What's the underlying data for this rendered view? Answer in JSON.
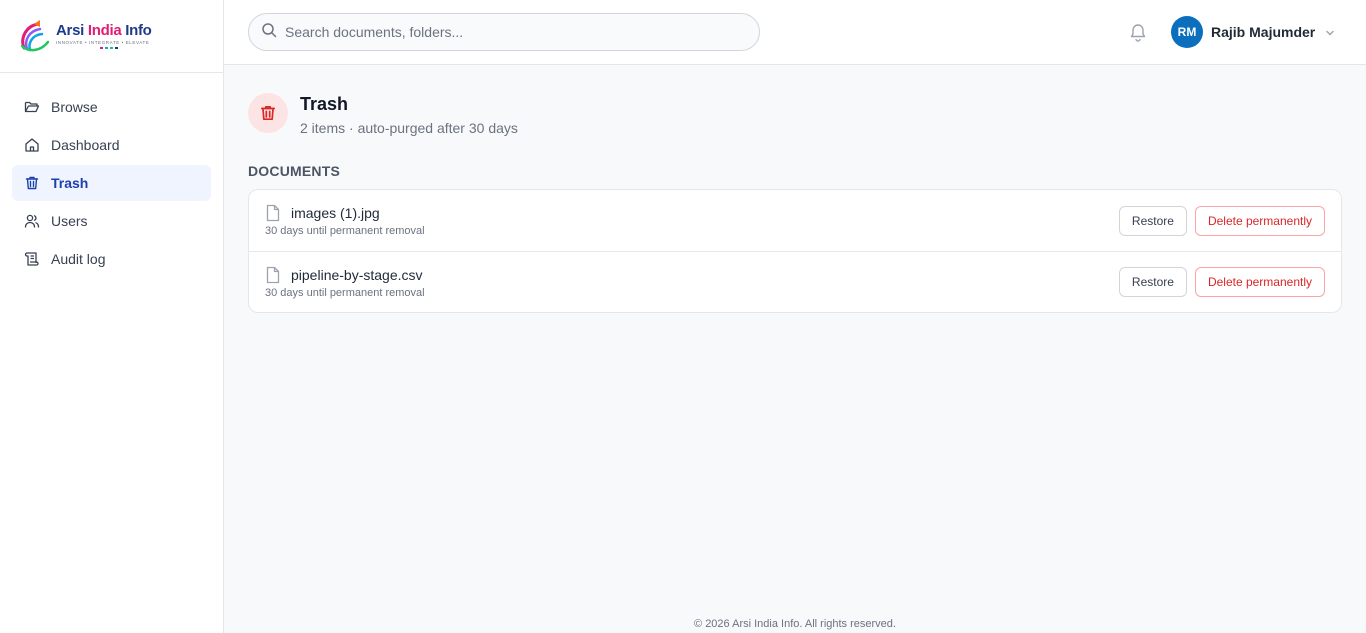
{
  "brand": {
    "name_part1": "Arsi",
    "name_part2": "India",
    "name_part3": "Info",
    "tagline": "INNOVATE • INTEGRATE • ELEVATE"
  },
  "sidebar": {
    "items": [
      {
        "label": "Browse",
        "icon": "folder-open-icon"
      },
      {
        "label": "Dashboard",
        "icon": "home-icon"
      },
      {
        "label": "Trash",
        "icon": "trash-icon",
        "active": true
      },
      {
        "label": "Users",
        "icon": "users-icon"
      },
      {
        "label": "Audit log",
        "icon": "scroll-icon"
      }
    ]
  },
  "header": {
    "search_placeholder": "Search documents, folders...",
    "user_initials": "RM",
    "user_name": "Rajib Majumder"
  },
  "page": {
    "title": "Trash",
    "subtitle": "2 items · auto-purged after 30 days",
    "section_label": "DOCUMENTS"
  },
  "documents": [
    {
      "name": "images (1).jpg",
      "meta": "30 days until permanent removal",
      "restore_label": "Restore",
      "delete_label": "Delete permanently"
    },
    {
      "name": "pipeline-by-stage.csv",
      "meta": "30 days until permanent removal",
      "restore_label": "Restore",
      "delete_label": "Delete permanently"
    }
  ],
  "footer": {
    "text": "© 2026 Arsi India Info. All rights reserved."
  },
  "colors": {
    "accent": "#1e40af",
    "avatar": "#0b6fbe",
    "danger": "#dc2626",
    "brand_pink": "#e11d74"
  }
}
